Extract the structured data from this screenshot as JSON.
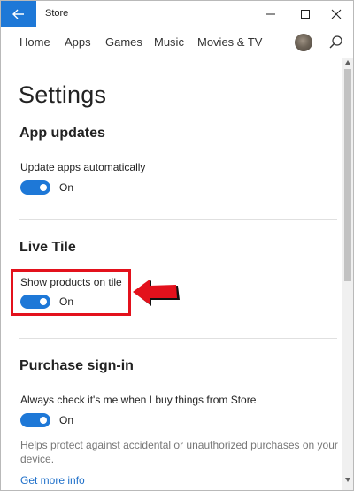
{
  "window": {
    "title": "Store"
  },
  "titlebar": {
    "back_icon": "back-arrow-icon",
    "minimize_icon": "minimize-icon",
    "maximize_icon": "maximize-icon",
    "close_icon": "close-icon"
  },
  "nav": {
    "items": [
      {
        "label": "Home"
      },
      {
        "label": "Apps"
      },
      {
        "label": "Games"
      },
      {
        "label": "Music"
      },
      {
        "label": "Movies & TV"
      }
    ],
    "search_icon": "search-icon"
  },
  "page": {
    "title": "Settings"
  },
  "sections": {
    "app_updates": {
      "heading": "App updates",
      "setting_label": "Update apps automatically",
      "toggle_state": "On"
    },
    "live_tile": {
      "heading": "Live Tile",
      "setting_label": "Show products on tile",
      "toggle_state": "On"
    },
    "purchase_signin": {
      "heading": "Purchase sign-in",
      "setting_label": "Always check it's me when I buy things from Store",
      "toggle_state": "On",
      "helper_text": "Helps protect against accidental or unauthorized purchases on your device.",
      "link_text": "Get more info"
    }
  },
  "colors": {
    "accent": "#1e78d7",
    "annotation_red": "#e3111c",
    "link": "#1e6fc9"
  }
}
